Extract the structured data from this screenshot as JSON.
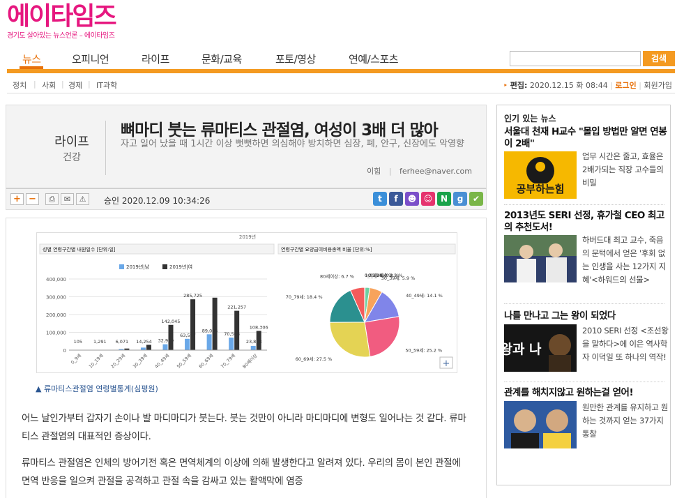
{
  "logo": {
    "title": "에이타임즈",
    "slogan": "경기도 살아있는 뉴스언론 – 에이타임즈"
  },
  "nav": {
    "items": [
      "뉴스",
      "오피니언",
      "라이프",
      "문화/교육",
      "포토/영상",
      "연예/스포츠"
    ],
    "active": "뉴스"
  },
  "search": {
    "placeholder": "",
    "button": "검색"
  },
  "subnav": {
    "items": [
      "정치",
      "사회",
      "경제",
      "IT과학"
    ]
  },
  "header_info": {
    "edit_label": "편집:",
    "edit_time": "2020.12.15 화 08:44",
    "login": "로그인",
    "signup": "회원가입"
  },
  "article": {
    "section": "라이프",
    "subsection": "건강",
    "title": "뼈마디 붓는 류마티스 관절염, 여성이 3배 더 많아",
    "subtitle": "자고 일어 났을 때 1시간 이상 뻣뻣하면 의심해야 방치하면 심장, 폐, 안구, 신장에도 악영향",
    "reporter": "이힘",
    "email": "ferhee@naver.com",
    "approved_label": "승인",
    "approved_time": "2020.12.09  10:34:26",
    "figure_caption": "류마티스관절염 연령별통계(심평원)",
    "paragraphs": [
      "어느 날인가부터 갑자기 손이나 발 마디마디가 붓는다. 붓는 것만이 아니라 마디마디에 변형도 일어나는 것 같다. 류마티스 관절염의 대표적인 증상이다.",
      "류마티스 관절염은 인체의 방어기전 혹은 면역체계의 이상에 의해 발생한다고 알려져 있다. 우리의 몸이 본인 관절에 면역 반응을 일으켜 관절을 공격하고 관절 속을 감싸고 있는 활액막에 염증"
    ]
  },
  "tools": {
    "font_up": "+",
    "font_down": "−"
  },
  "share": {
    "colors": [
      "#3b8fd9",
      "#3b5998",
      "#7b4fc9",
      "#e5336e",
      "#19a34a",
      "#4a8fd4",
      "#7ab648"
    ],
    "labels": [
      "t",
      "f",
      "☻",
      "☺",
      "N",
      "g",
      "✔"
    ]
  },
  "chart_data": [
    {
      "type": "bar",
      "title": "성별 연령구간별 내원일수 [단위:일]",
      "year_label": "2019년",
      "categories": [
        "0_9세",
        "10_19세",
        "20_29세",
        "30_39세",
        "40_49세",
        "50_59세",
        "60_69세",
        "70_79세",
        "80세이상"
      ],
      "series": [
        {
          "name": "2019년|남",
          "color": "#6aa8e8",
          "values": [
            105,
            1291,
            6071,
            14254,
            32969,
            63597,
            89005,
            70508,
            23878
          ]
        },
        {
          "name": "2019년|여",
          "color": "#333333",
          "values": [
            320,
            1600,
            9000,
            30000,
            142045,
            285725,
            295000,
            221257,
            108306
          ]
        }
      ],
      "labels": [
        "105",
        "1,291",
        "6,071",
        "14,254",
        "32,969",
        "63,597",
        "89,005",
        "70,508",
        "23,878"
      ],
      "labels_female": [
        "",
        "",
        "",
        "",
        "142,045",
        "285,725",
        "",
        "221,257",
        "108,306"
      ],
      "ylim": [
        0,
        400000
      ],
      "yticks": [
        "400,000",
        "300,000",
        "200,000",
        "100,000",
        "0"
      ],
      "grid": true,
      "legend": "top"
    },
    {
      "type": "pie",
      "title": "연령구간별 요양급여비용총액 비율 [단위:%]",
      "slices": [
        {
          "label": "0_9세: 0.0 %",
          "value": 0.0,
          "color": "#7cb5ec"
        },
        {
          "label": "10_19세: 0.2 %",
          "value": 0.2,
          "color": "#90ed7d"
        },
        {
          "label": "20_29세: 2.2 %",
          "value": 2.2,
          "color": "#6ed0a2"
        },
        {
          "label": "30_39세: 5.9 %",
          "value": 5.9,
          "color": "#f7a35c"
        },
        {
          "label": "40_49세: 14.1 %",
          "value": 14.1,
          "color": "#8085e9"
        },
        {
          "label": "50_59세: 25.2 %",
          "value": 25.2,
          "color": "#f15c80"
        },
        {
          "label": "60_69세: 27.5 %",
          "value": 27.5,
          "color": "#e4d354"
        },
        {
          "label": "70_79세: 18.4 %",
          "value": 18.4,
          "color": "#2b908f"
        },
        {
          "label": "80세이상: 6.7 %",
          "value": 6.7,
          "color": "#f45b5b"
        }
      ]
    }
  ],
  "sidebar": {
    "title": "인기 있는 뉴스",
    "items": [
      {
        "title": "서울대 천재 H교수 \"몰입 방법만 알면 연봉이 2배\"",
        "desc": "업무 시간은 줄고, 효율은 2배가되는 직장 고수들의 비밀",
        "thumb": "공부하는힘"
      },
      {
        "title": "2013년도 SERI 선정, 휴가철 CEO 최고의 추천도서!",
        "desc": "하버드대 최고 교수, 죽음의 문턱에서 얻은 '후회 없는 인생을 사는 12가지 지혜'<하워드의 선물>",
        "thumb": ""
      },
      {
        "title": "나를 만나고 그는 왕이 되었다",
        "desc": "2010 SERI 선정 <조선왕을 말하다>에 이은 역사학자 이덕일 또 하나의 역작!",
        "thumb": "왕과 나"
      },
      {
        "title": "관계를 해치지않고 원하는걸 얻어!",
        "desc": "원만한 관계를 유지하고 원하는 것까지 얻는 37가지 통찰",
        "thumb": ""
      }
    ]
  }
}
